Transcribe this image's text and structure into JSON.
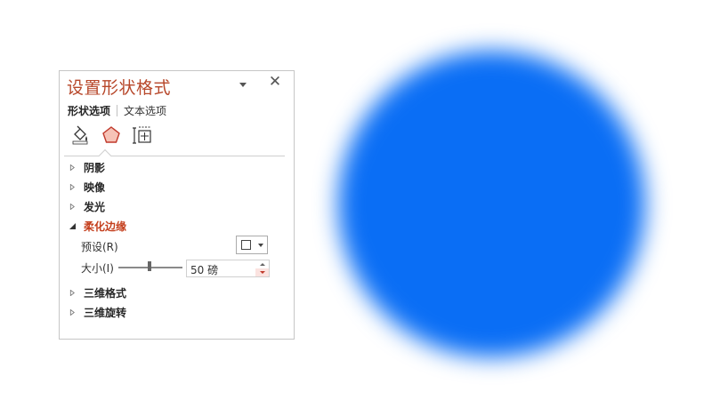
{
  "pane": {
    "title": "设置形状格式",
    "close_label": "✕",
    "tabs": [
      {
        "label": "形状选项",
        "active": true
      },
      {
        "label": "文本选项",
        "active": false
      }
    ],
    "icons": [
      "fill-line-icon",
      "effects-icon",
      "size-properties-icon"
    ],
    "sections": [
      {
        "label": "阴影",
        "expanded": false
      },
      {
        "label": "映像",
        "expanded": false
      },
      {
        "label": "发光",
        "expanded": false
      },
      {
        "label": "柔化边缘",
        "expanded": true
      },
      {
        "label": "三维格式",
        "expanded": false
      },
      {
        "label": "三维旋转",
        "expanded": false
      }
    ],
    "soft_edges": {
      "preset_label": "预设(R)",
      "size_label": "大小(I)",
      "size_value": "50 磅"
    }
  },
  "canvas": {
    "shape": "soft-edged circle",
    "fill_color": "#0a6ef5"
  },
  "colors": {
    "accent": "#b7472a",
    "section_expanded": "#c43e1c"
  }
}
